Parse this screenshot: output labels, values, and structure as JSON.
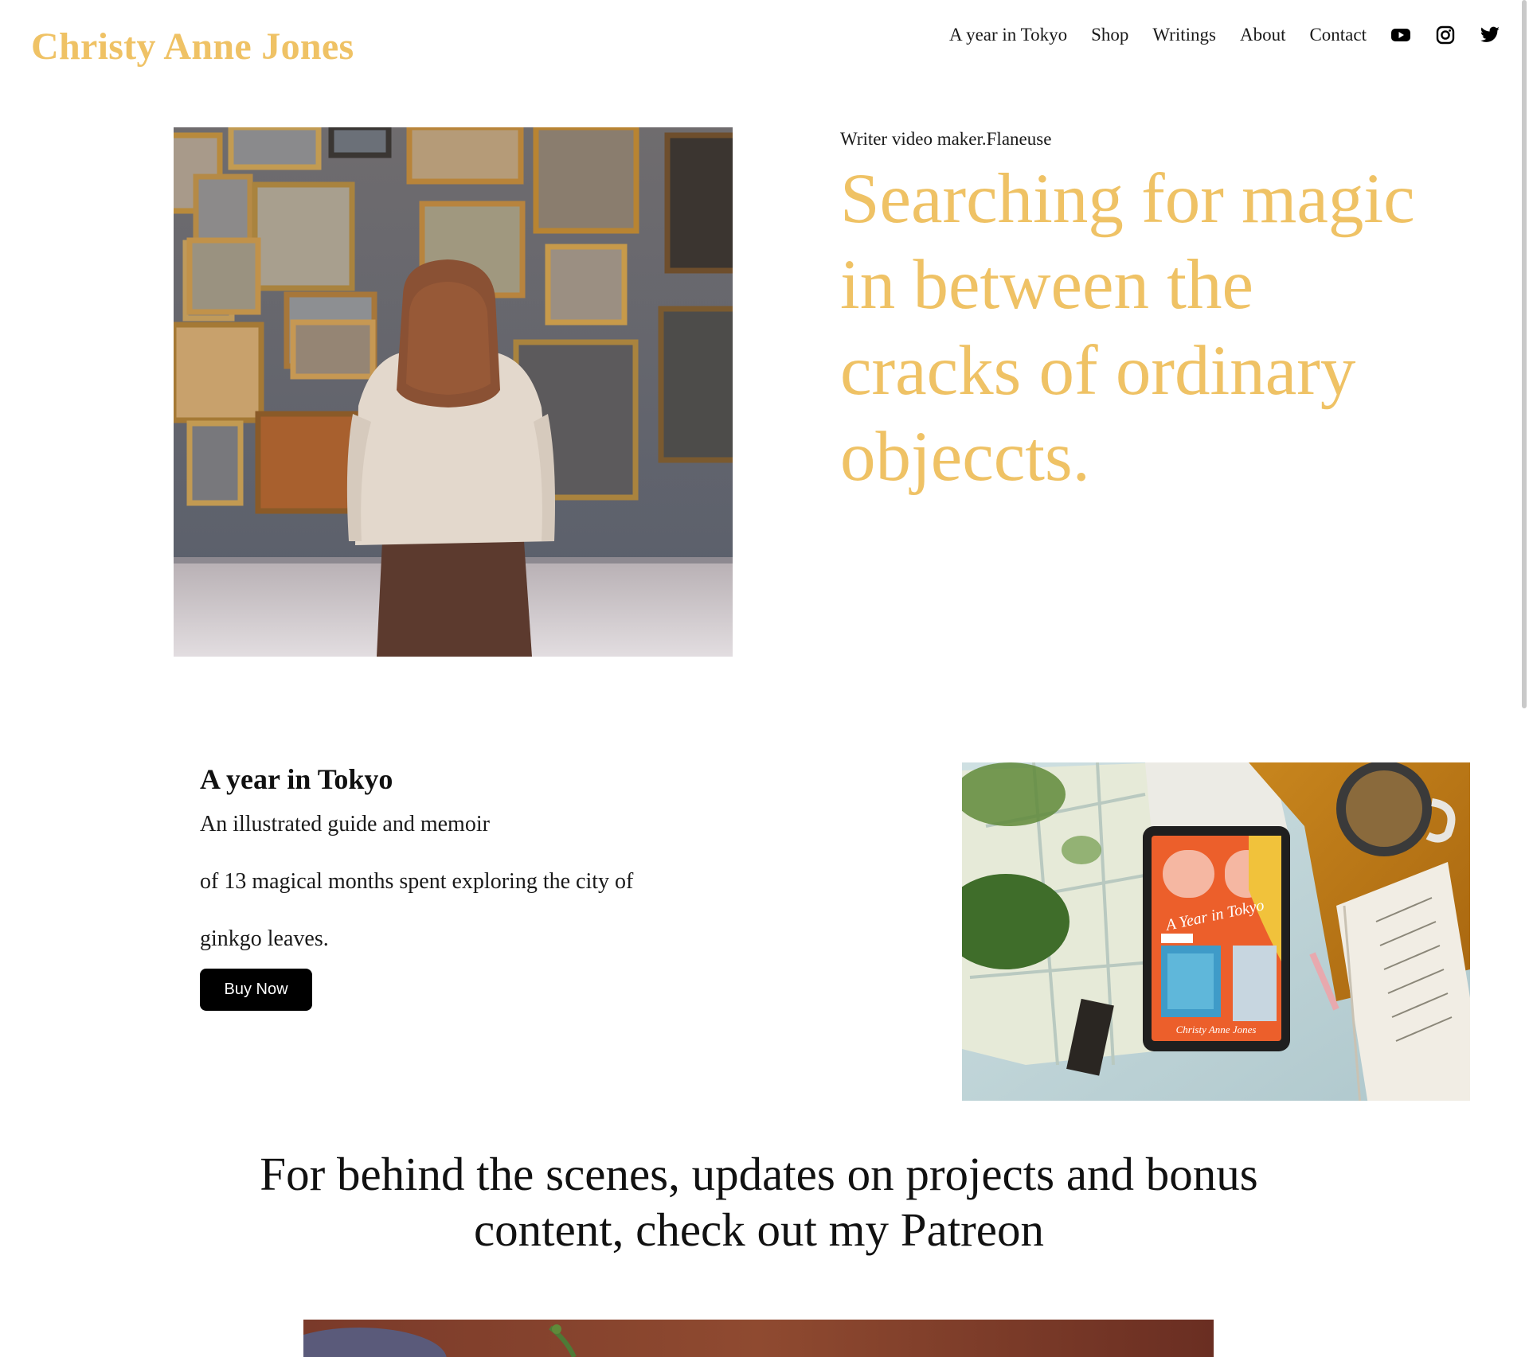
{
  "site": {
    "title": "Christy Anne Jones",
    "accent_color": "#efc265"
  },
  "nav": {
    "items": [
      {
        "label": "A year in Tokyo"
      },
      {
        "label": "Shop"
      },
      {
        "label": "Writings"
      },
      {
        "label": "About"
      },
      {
        "label": "Contact"
      }
    ],
    "social": [
      {
        "icon": "youtube-icon"
      },
      {
        "icon": "instagram-icon"
      },
      {
        "icon": "twitter-icon"
      }
    ]
  },
  "hero": {
    "subtitle": "Writer video maker.Flaneuse",
    "headline": "Searching for magic in between the cracks of ordinary objeccts.",
    "image": "woman-viewing-gallery-paintings"
  },
  "feature": {
    "title": "A year in Tokyo",
    "description": [
      "An illustrated guide and memoir",
      "of 13 magical months spent exploring the city of",
      "ginkgo leaves."
    ],
    "button_label": "Buy Now",
    "image": "tablet-showing-book-cover",
    "image_cover_title": "A Year in Tokyo",
    "image_cover_author": "Christy Anne Jones"
  },
  "patreon": {
    "heading": "For behind the scenes, updates on projects and bonus content, check out my Patreon"
  }
}
